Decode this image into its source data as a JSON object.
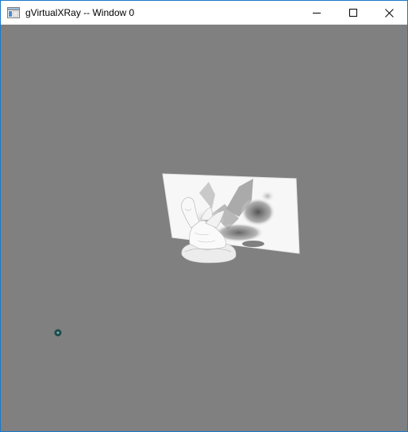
{
  "window": {
    "title": "gVirtualXRay -- Window 0",
    "icon": "app-window-icon",
    "controls": {
      "minimize_icon": "minimize-icon",
      "maximize_icon": "maximize-icon",
      "close_icon": "close-icon"
    }
  },
  "viewport": {
    "background_color": "#808080",
    "scene_objects": [
      "dragon-statue-model",
      "xray-detector-plane",
      "xray-source-point"
    ]
  }
}
